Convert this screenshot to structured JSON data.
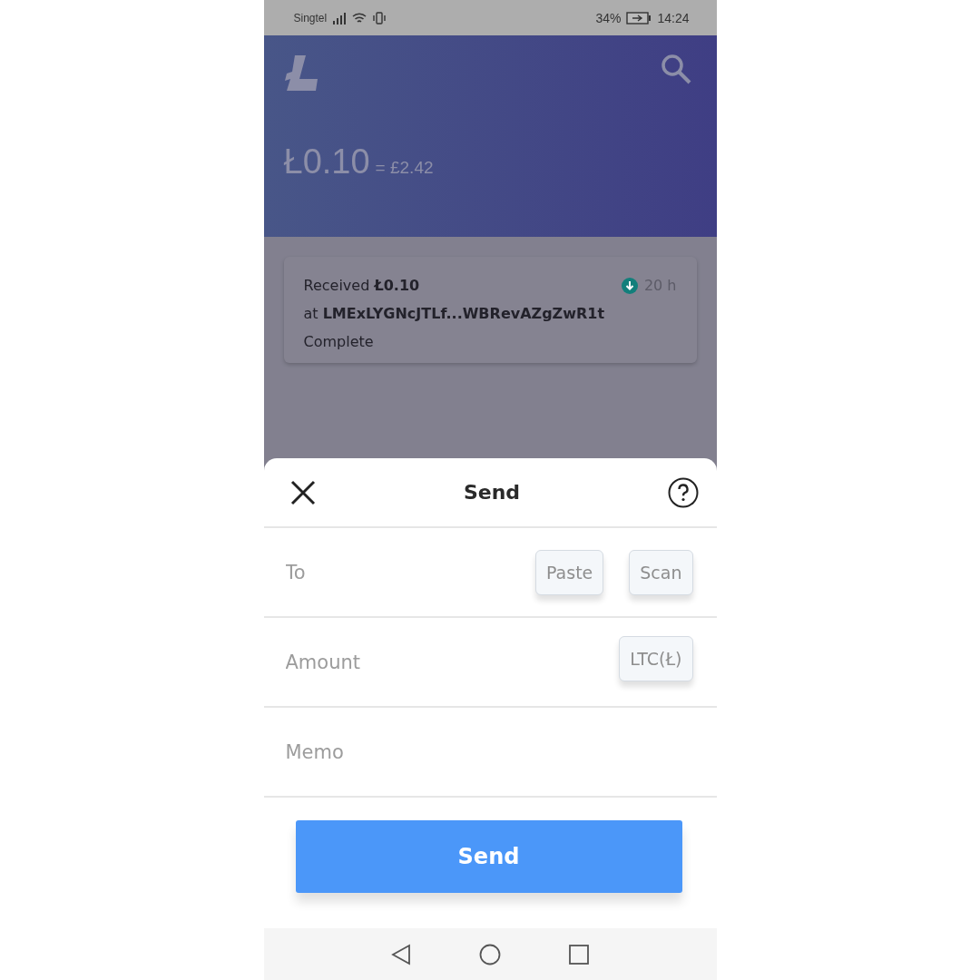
{
  "status_bar": {
    "carrier": "Singtel",
    "battery": "34%",
    "time": "14:24"
  },
  "header": {
    "balance": "Ł0.10",
    "fiat": "= £2.42"
  },
  "transactions": [
    {
      "line1": "Received **Ł0.10**",
      "line2": "at **LMExLYGNcJTLf...WBRevAZgZwR1t**",
      "status": "Complete",
      "time": "20 h"
    }
  ],
  "sheet": {
    "title": "Send",
    "fields": [
      {
        "placeholder": "To",
        "buttons": [
          "Paste",
          "Scan"
        ]
      },
      {
        "placeholder": "Amount",
        "buttons": [
          "LTC(Ł)"
        ]
      },
      {
        "placeholder": "Memo"
      }
    ],
    "submit": "Send"
  }
}
